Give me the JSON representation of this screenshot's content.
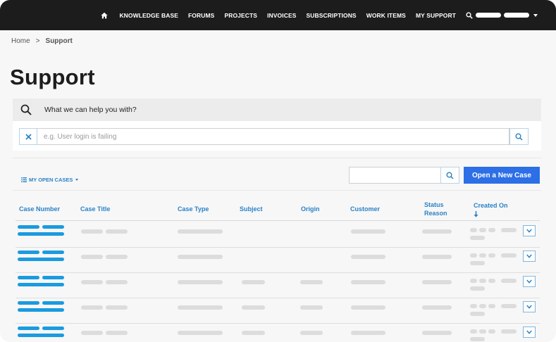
{
  "nav": {
    "items": [
      {
        "label": "KNOWLEDGE BASE"
      },
      {
        "label": "FORUMS"
      },
      {
        "label": "PROJECTS"
      },
      {
        "label": "INVOICES"
      },
      {
        "label": "SUBSCRIPTIONS"
      },
      {
        "label": "WORK ITEMS"
      },
      {
        "label": "MY SUPPORT"
      }
    ]
  },
  "breadcrumb": {
    "home": "Home",
    "separator": ">",
    "current": "Support"
  },
  "page": {
    "title": "Support"
  },
  "help": {
    "prompt": "What we can help you with?",
    "placeholder": "e.g. User login is failing"
  },
  "cases": {
    "view_label": "MY OPEN CASES",
    "new_case_label": "Open a New Case",
    "columns": [
      {
        "label": "Case Number"
      },
      {
        "label": "Case Title"
      },
      {
        "label": "Case Type"
      },
      {
        "label": "Subject"
      },
      {
        "label": "Origin"
      },
      {
        "label": "Customer"
      },
      {
        "label": "Status Reason"
      },
      {
        "label": "Created On"
      }
    ],
    "sort_column": "Created On",
    "sort_direction": "descending",
    "row_count": 5
  },
  "colors": {
    "nav_background": "#1c1c1c",
    "accent": "#2b82c6",
    "primary_button": "#2c6fe6",
    "case_number_placeholder": "#1a9be0"
  }
}
